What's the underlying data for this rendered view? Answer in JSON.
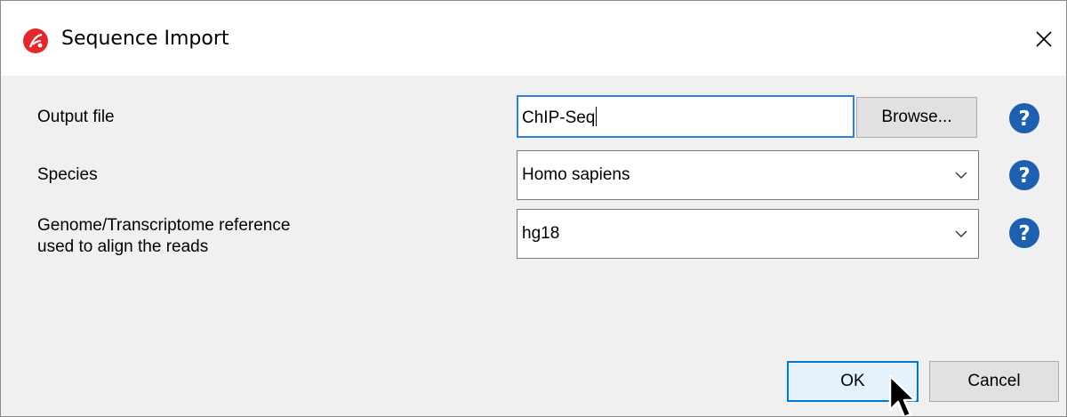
{
  "window": {
    "title": "Sequence Import",
    "app_icon": "partek-logo-icon",
    "close_icon": "close-icon"
  },
  "form": {
    "output_file": {
      "label": "Output file",
      "value": "ChIP-Seq",
      "browse_label": "Browse..."
    },
    "species": {
      "label": "Species",
      "value": "Homo sapiens"
    },
    "reference": {
      "label_line1": "Genome/Transcriptome reference",
      "label_line2": "used to align the reads",
      "value": "hg18"
    },
    "help_icon": "question-circle-icon",
    "dropdown_icon": "chevron-down-icon"
  },
  "buttons": {
    "ok": "OK",
    "cancel": "Cancel"
  },
  "colors": {
    "accent": "#0078d7",
    "help": "#1e5fb0",
    "logo": "#e2282f"
  }
}
